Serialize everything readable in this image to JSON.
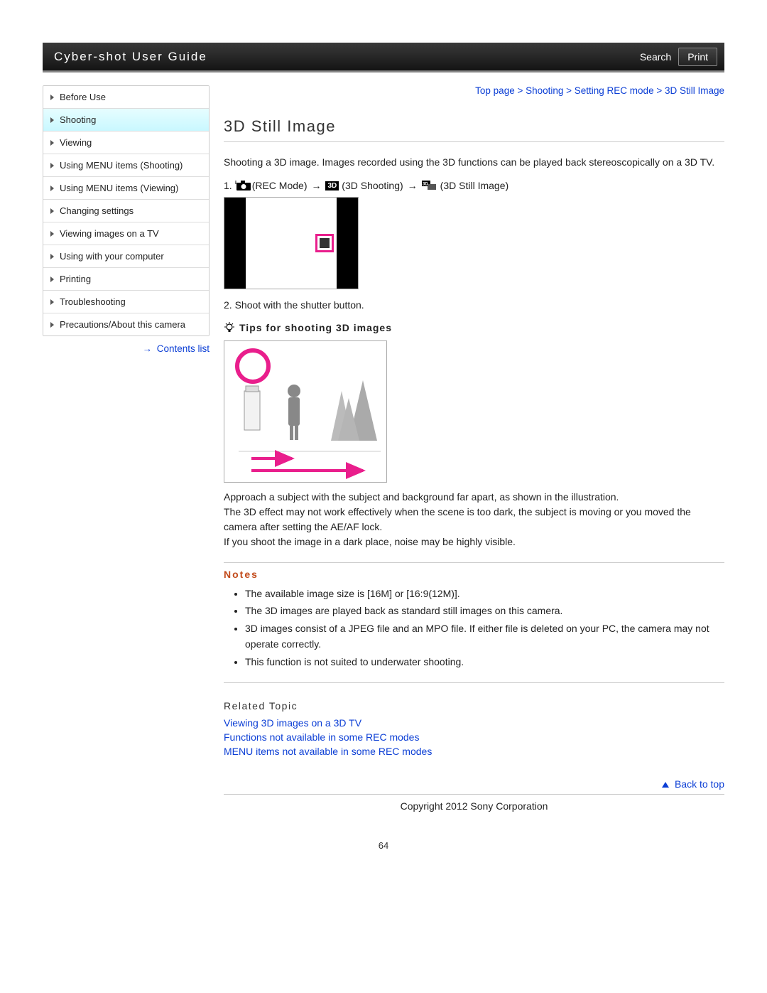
{
  "header": {
    "title": "Cyber-shot User Guide",
    "search_label": "Search",
    "print_label": "Print"
  },
  "sidebar": {
    "items": [
      {
        "label": "Before Use",
        "active": false
      },
      {
        "label": "Shooting",
        "active": true
      },
      {
        "label": "Viewing",
        "active": false
      },
      {
        "label": "Using MENU items (Shooting)",
        "active": false
      },
      {
        "label": "Using MENU items (Viewing)",
        "active": false
      },
      {
        "label": "Changing settings",
        "active": false
      },
      {
        "label": "Viewing images on a TV",
        "active": false
      },
      {
        "label": "Using with your computer",
        "active": false
      },
      {
        "label": "Printing",
        "active": false
      },
      {
        "label": "Troubleshooting",
        "active": false
      },
      {
        "label": "Precautions/About this camera",
        "active": false
      }
    ],
    "contents_link": "Contents list"
  },
  "breadcrumb": "Top page > Shooting > Setting REC mode > 3D Still Image",
  "title": "3D Still Image",
  "intro": "Shooting a 3D image. Images recorded using the 3D functions can be played back stereoscopically on a 3D TV.",
  "step1": {
    "num": "1.",
    "rec_mode": "(REC Mode)",
    "shooting3d": "(3D Shooting)",
    "still3d": "(3D Still Image)",
    "arrow": "→"
  },
  "step2": {
    "num": "2.",
    "text": "Shoot with the shutter button."
  },
  "tips": {
    "heading": "Tips for shooting 3D images",
    "text": "Approach a subject with the subject and background far apart, as shown in the illustration.\nThe 3D effect may not work effectively when the scene is too dark, the subject is moving or you moved the camera after setting the AE/AF lock.\nIf you shoot the image in a dark place, noise may be highly visible."
  },
  "notes": {
    "heading": "Notes",
    "items": [
      "The available image size is [16M] or [16:9(12M)].",
      "The 3D images are played back as standard still images on this camera.",
      "3D images consist of a JPEG file and an MPO file. If either file is deleted on your PC, the camera may not operate correctly.",
      "This function is not suited to underwater shooting."
    ]
  },
  "related": {
    "heading": "Related Topic",
    "links": [
      "Viewing 3D images on a 3D TV",
      "Functions not available in some REC modes",
      "MENU items not available in some REC modes"
    ]
  },
  "backtop": "Back to top",
  "copyright": "Copyright 2012 Sony Corporation",
  "pagenum": "64"
}
